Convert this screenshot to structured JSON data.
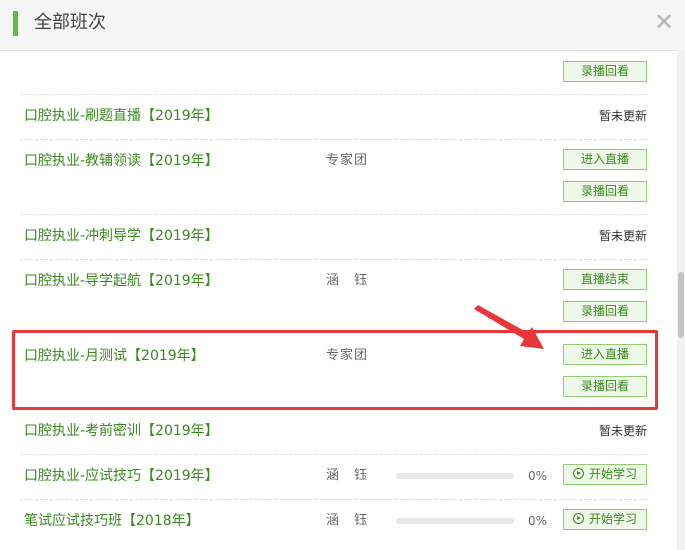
{
  "header": {
    "title": "全部班次",
    "close_icon": "close-icon"
  },
  "accent_color": "#5dbb46",
  "highlight_color": "#e8363b",
  "rows": [
    {
      "name": "",
      "teacher": "",
      "status": "",
      "buttons": [
        "录播回看"
      ]
    },
    {
      "name": "口腔执业-刷题直播【2019年】",
      "teacher": "",
      "status": "暂未更新",
      "buttons": []
    },
    {
      "name": "口腔执业-教辅领读【2019年】",
      "teacher": "专家团",
      "status": "",
      "buttons": [
        "进入直播",
        "录播回看"
      ]
    },
    {
      "name": "口腔执业-冲刺导学【2019年】",
      "teacher": "",
      "status": "暂未更新",
      "buttons": []
    },
    {
      "name": "口腔执业-导学起航【2019年】",
      "teacher": "涵　钰",
      "status": "",
      "buttons": [
        "直播结束",
        "录播回看"
      ]
    },
    {
      "name": "口腔执业-月测试【2019年】",
      "teacher": "专家团",
      "status": "",
      "buttons": [
        "进入直播",
        "录播回看"
      ]
    },
    {
      "name": "口腔执业-考前密训【2019年】",
      "teacher": "",
      "status": "暂未更新",
      "buttons": []
    },
    {
      "name": "口腔执业-应试技巧【2019年】",
      "teacher": "涵　钰",
      "status": "",
      "progress": 0,
      "progress_label": "0%",
      "buttons": [
        "开始学习"
      ]
    },
    {
      "name": "笔试应试技巧班【2018年】",
      "teacher": "涵　钰",
      "status": "",
      "progress": 0,
      "progress_label": "0%",
      "buttons": [
        "开始学习"
      ]
    }
  ]
}
